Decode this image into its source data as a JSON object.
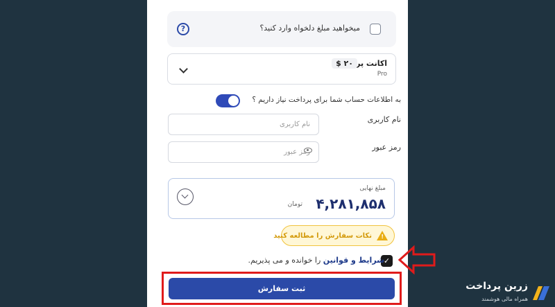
{
  "custom_amount": {
    "label": "میخواهید مبلغ دلخواه وارد کنید؟",
    "help_glyph": "?"
  },
  "plan": {
    "name": "اکانت پرو",
    "price": "$ ۲۰",
    "subtitle": "Pro"
  },
  "account_info": {
    "question": "به اطلاعات حساب شما برای پرداخت نیاز داریم ؟",
    "toggle_on": true
  },
  "username": {
    "label": "نام کاربری",
    "placeholder": "نام کاربری"
  },
  "password": {
    "label": "رمز عبور",
    "placeholder": "رمز عبور"
  },
  "total": {
    "label": "مبلغ نهایی",
    "amount": "۴,۲۸۱,۸۵۸",
    "currency": "تومان"
  },
  "notes": {
    "label": "نکات سفارش را مطالعه کنید",
    "warn_glyph": "!"
  },
  "terms": {
    "link_text": "شرایط و قوانین",
    "rest_text": " را خوانده و می پذیریم.",
    "checked_glyph": "✓"
  },
  "submit": {
    "label": "ثبت سفارش"
  },
  "brand": {
    "name": "زرین پرداخت",
    "tagline": "همراه مالی هوشمند"
  },
  "colors": {
    "primary": "#2b4aa8",
    "background": "#1f3340",
    "annotation": "#e01b1b",
    "warning": "#e9ad14"
  }
}
